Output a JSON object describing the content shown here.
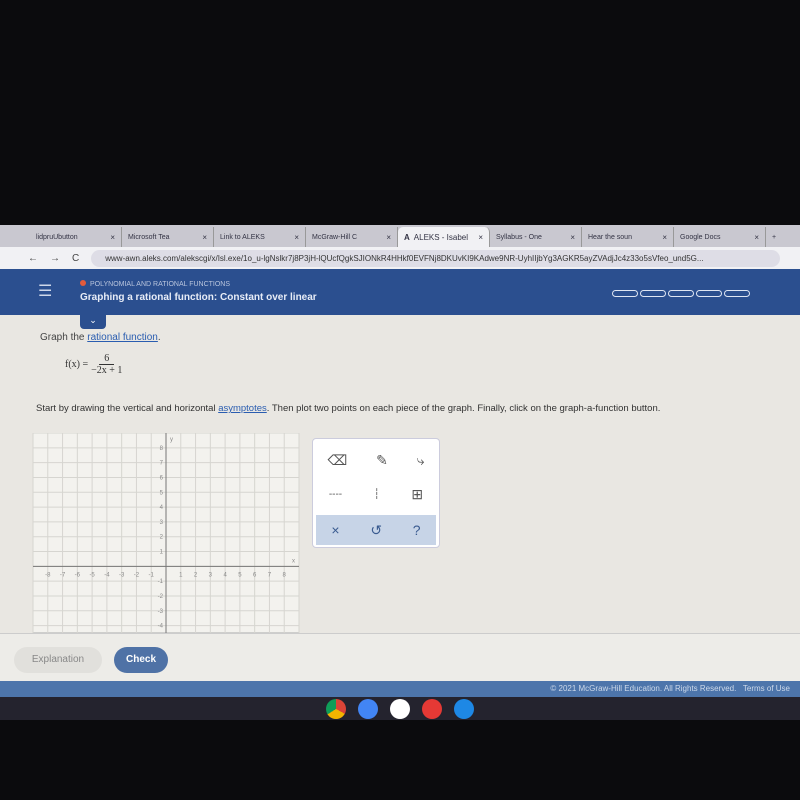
{
  "browser": {
    "tabs": [
      {
        "label": "lidpruUbutton"
      },
      {
        "label": "Microsoft Tea"
      },
      {
        "label": "Link to ALEKS"
      },
      {
        "label": "McGraw-Hill C"
      },
      {
        "label": "ALEKS - Isabel",
        "active": true
      },
      {
        "label": "Syllabus - One"
      },
      {
        "label": "Hear the soun"
      },
      {
        "label": "Google Docs"
      }
    ],
    "url": "www-awn.aleks.com/alekscgi/x/Isl.exe/1o_u-lgNslkr7j8P3jH-lQUcfQgkSJIONkR4HHkf0EVFNj8DKUvKI9KAdwe9NR-UyhIIjbYg3AGKR5ayZVAdjJc4z33o5sVfeo_und5G..."
  },
  "header": {
    "topic": "Polynomial and Rational Functions",
    "title": "Graphing a rational function: Constant over linear",
    "progress_segments": 5
  },
  "problem": {
    "prompt_prefix": "Graph the ",
    "prompt_link": "rational function",
    "prompt_suffix": ".",
    "fx_label": "f(x) =",
    "numerator": "6",
    "denominator": "−2x + 1",
    "instr_prefix": "Start by drawing the vertical and horizontal ",
    "instr_link": "asymptotes",
    "instr_suffix": ". Then plot two points on each piece of the graph. Finally, click on the graph-a-function button."
  },
  "graph": {
    "x_label": "x",
    "y_label": "y",
    "xlim": [
      -9,
      9
    ],
    "ylim": [
      -4.5,
      9
    ],
    "x_ticks": [
      -8,
      -7,
      -6,
      -5,
      -4,
      -3,
      -2,
      -1,
      1,
      2,
      3,
      4,
      5,
      6,
      7,
      8
    ],
    "y_ticks": [
      -4,
      -3,
      -2,
      -1,
      1,
      2,
      3,
      4,
      5,
      6,
      7,
      8
    ]
  },
  "tools": {
    "icons": [
      "eraser-icon",
      "pencil-icon",
      "curve-icon",
      "horizontal-asymptote-icon",
      "vertical-asymptote-icon",
      "graph-function-icon",
      "clear-icon",
      "undo-icon",
      "help-icon"
    ],
    "clear": "×",
    "undo": "↺",
    "help": "?"
  },
  "buttons": {
    "explanation": "Explanation",
    "check": "Check"
  },
  "footer": {
    "copyright": "© 2021 McGraw-Hill Education. All Rights Reserved.",
    "terms": "Terms of Use"
  }
}
